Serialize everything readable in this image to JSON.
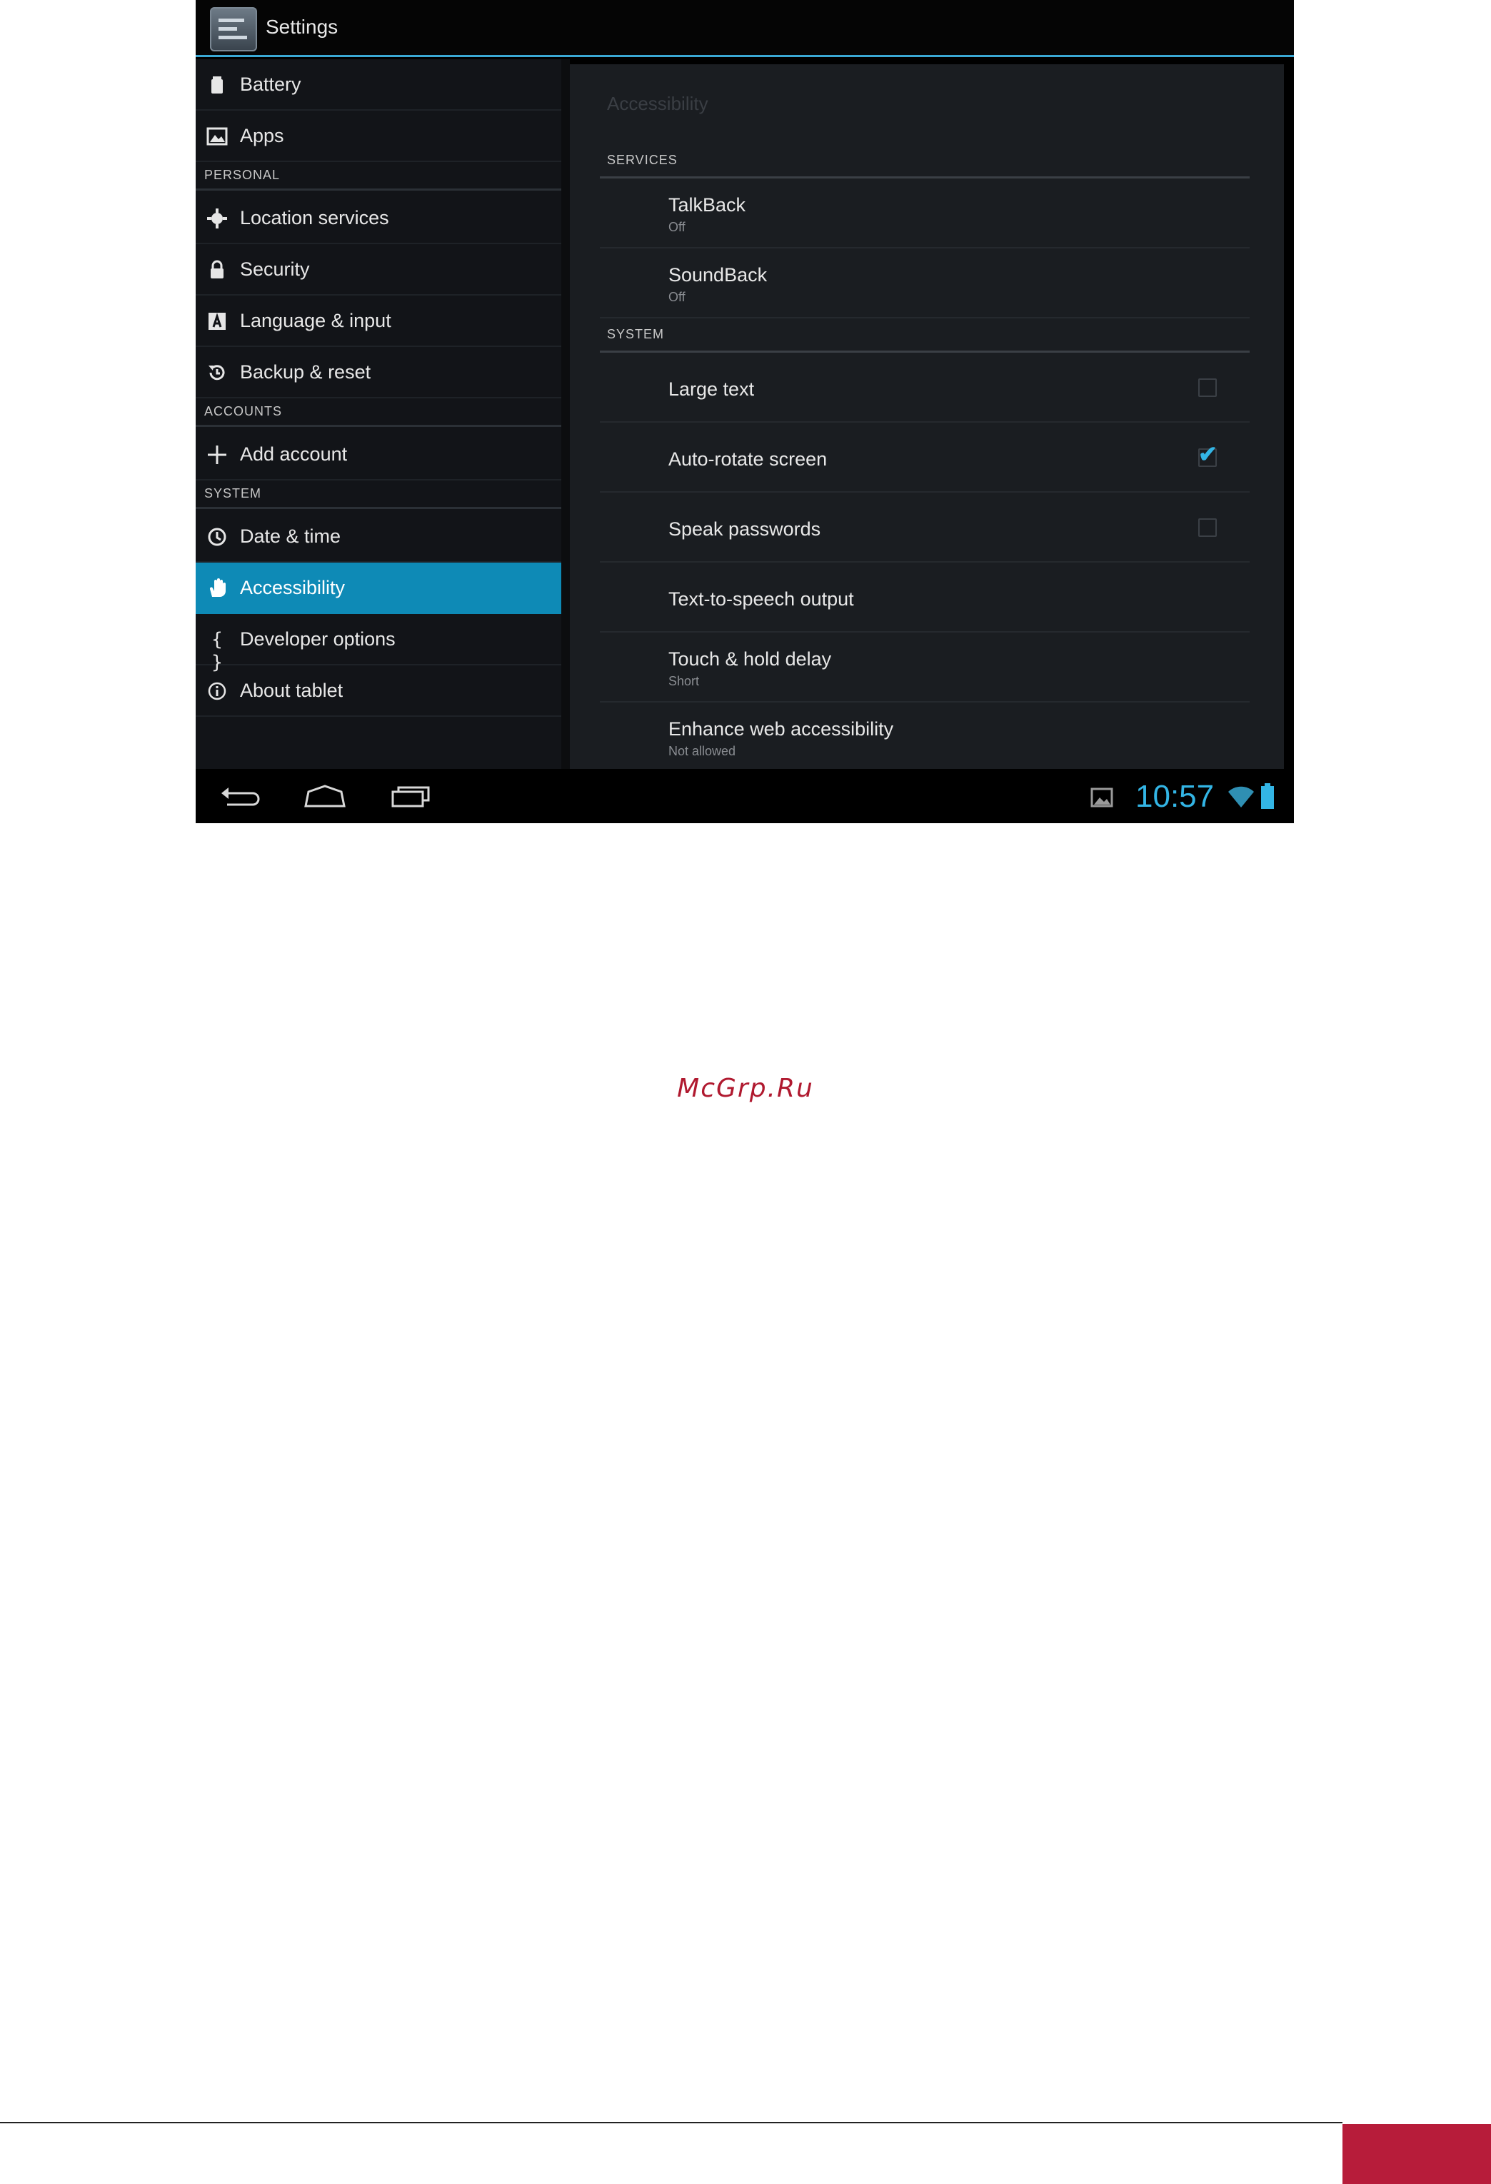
{
  "action_bar": {
    "title": "Settings"
  },
  "sidebar": {
    "items": [
      {
        "kind": "item",
        "label": "Battery",
        "icon": "battery-icon"
      },
      {
        "kind": "item",
        "label": "Apps",
        "icon": "apps-icon"
      },
      {
        "kind": "header",
        "label": "PERSONAL"
      },
      {
        "kind": "item",
        "label": "Location services",
        "icon": "location-icon"
      },
      {
        "kind": "item",
        "label": "Security",
        "icon": "lock-icon"
      },
      {
        "kind": "item",
        "label": "Language & input",
        "icon": "keyboard-icon"
      },
      {
        "kind": "item",
        "label": "Backup & reset",
        "icon": "backup-icon"
      },
      {
        "kind": "header",
        "label": "ACCOUNTS"
      },
      {
        "kind": "item",
        "label": "Add account",
        "icon": "plus-icon"
      },
      {
        "kind": "header",
        "label": "SYSTEM"
      },
      {
        "kind": "item",
        "label": "Date & time",
        "icon": "clock-icon"
      },
      {
        "kind": "item",
        "label": "Accessibility",
        "icon": "hand-icon",
        "selected": true
      },
      {
        "kind": "item",
        "label": "Developer options",
        "icon": "braces-icon"
      },
      {
        "kind": "item",
        "label": "About tablet",
        "icon": "info-icon"
      }
    ]
  },
  "detail": {
    "title": "Accessibility",
    "services_header": "SERVICES",
    "talkback": {
      "title": "TalkBack",
      "summary": "Off"
    },
    "soundback": {
      "title": "SoundBack",
      "summary": "Off"
    },
    "system_header": "SYSTEM",
    "large_text": {
      "title": "Large text",
      "checked": false
    },
    "auto_rotate": {
      "title": "Auto-rotate screen",
      "checked": true
    },
    "speak_passwords": {
      "title": "Speak passwords",
      "checked": false
    },
    "tts_output": {
      "title": "Text-to-speech output"
    },
    "touch_hold": {
      "title": "Touch & hold delay",
      "summary": "Short"
    },
    "enhance_web": {
      "title": "Enhance web accessibility",
      "summary": "Not allowed"
    }
  },
  "system_bar": {
    "buttons": [
      "back-icon",
      "home-icon",
      "recent-apps-icon"
    ],
    "clock": "10:57",
    "status_icons": [
      "gallery-notification-icon",
      "wifi-icon",
      "battery-status-icon"
    ]
  },
  "page": {
    "watermark": "McGrp.Ru",
    "accent_color": "#b71c3a",
    "highlight_color": "#0e8ab6",
    "clock_color": "#33b5e5"
  }
}
